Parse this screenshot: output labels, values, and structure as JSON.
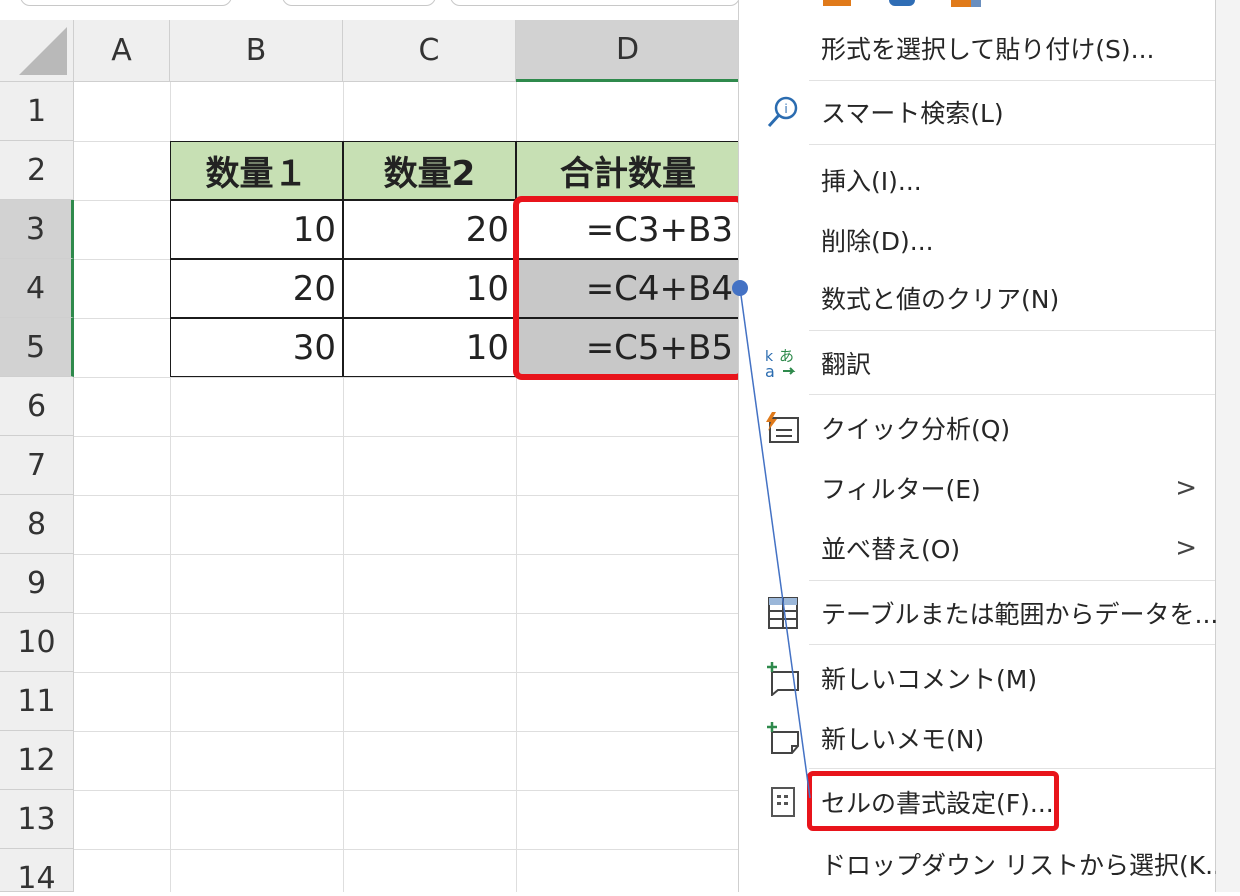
{
  "columns": [
    "A",
    "B",
    "C",
    "D"
  ],
  "rows": [
    "1",
    "2",
    "3",
    "4",
    "5",
    "6",
    "7",
    "8",
    "9",
    "10",
    "11",
    "12",
    "13",
    "14"
  ],
  "table": {
    "headers": [
      "数量１",
      "数量2",
      "合計数量"
    ],
    "body": [
      [
        "10",
        "20",
        "=C3+B3"
      ],
      [
        "20",
        "10",
        "=C4+B4"
      ],
      [
        "30",
        "10",
        "=C5+B5"
      ]
    ]
  },
  "menu": {
    "items": [
      {
        "label": "形式を選択して貼り付け(S)...",
        "icon": "none"
      },
      {
        "label": "スマート検索(L)",
        "icon": "smart-lookup-icon"
      },
      {
        "label": "挿入(I)...",
        "icon": "none"
      },
      {
        "label": "削除(D)...",
        "icon": "none"
      },
      {
        "label": "数式と値のクリア(N)",
        "icon": "none"
      },
      {
        "label": "翻訳",
        "icon": "translate-icon"
      },
      {
        "label": "クイック分析(Q)",
        "icon": "quick-analysis-icon"
      },
      {
        "label": "フィルター(E)",
        "icon": "none",
        "submenu": true
      },
      {
        "label": "並べ替え(O)",
        "icon": "none",
        "submenu": true
      },
      {
        "label": "テーブルまたは範囲からデータを...",
        "icon": "table-icon"
      },
      {
        "label": "新しいコメント(M)",
        "icon": "new-comment-icon"
      },
      {
        "label": "新しいメモ(N)",
        "icon": "new-note-icon"
      },
      {
        "label": "セルの書式設定(F)...",
        "icon": "format-cells-icon"
      },
      {
        "label": "ドロップダウン リストから選択(K...",
        "icon": "none"
      }
    ],
    "submenu_arrow": ">"
  },
  "colors": {
    "header_fill": "#c7e0b4",
    "highlight_red": "#e8141b",
    "selected_header": "#2f8a4c",
    "selected_fill": "#c8c8c8"
  }
}
